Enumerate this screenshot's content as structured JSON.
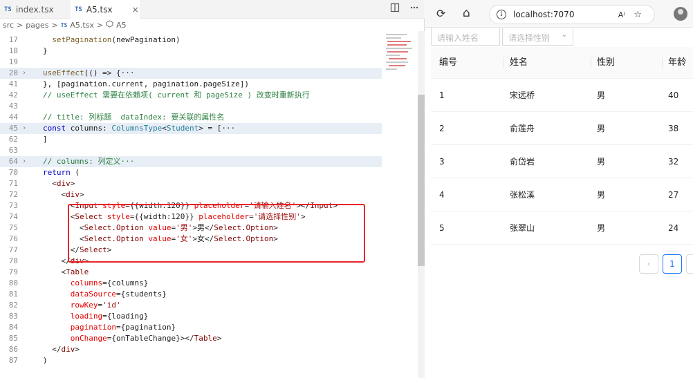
{
  "editor": {
    "tabs": [
      {
        "prefix": "TS",
        "label": "index.tsx"
      },
      {
        "prefix": "TS",
        "label": "A5.tsx",
        "close": "×"
      }
    ],
    "breadcrumb": {
      "src": "src",
      "pages": "pages",
      "prefix": "TS",
      "file": "A5.tsx",
      "symbol": "A5",
      "sep": ">"
    },
    "fold_glyph": "›",
    "lines": [
      {
        "n": "17",
        "t": "  setPagination(newPagination)"
      },
      {
        "n": "18",
        "t": "}"
      },
      {
        "n": "19",
        "t": ""
      },
      {
        "n": "20",
        "t": "useEffect(() => {···",
        "fold": true
      },
      {
        "n": "41",
        "t": "}, [pagination.current, pagination.pageSize])"
      },
      {
        "n": "42",
        "t": "// useEffect 需要在依赖项( current 和 pageSize ) 改变时重新执行"
      },
      {
        "n": "43",
        "t": ""
      },
      {
        "n": "44",
        "t": "// title: 列标题  dataIndex: 要关联的属性名"
      },
      {
        "n": "45",
        "t": "const columns: ColumnsType<Student> = [···",
        "fold": true
      },
      {
        "n": "62",
        "t": "]"
      },
      {
        "n": "63",
        "t": ""
      },
      {
        "n": "64",
        "t": "// columns: 列定义···",
        "fold": true
      },
      {
        "n": "70",
        "t": "return ("
      },
      {
        "n": "71",
        "t": "  <div>"
      },
      {
        "n": "72",
        "t": "    <div>"
      },
      {
        "n": "73",
        "t": "      <Input style={{width:120}} placeholder='请输入姓名'></Input>"
      },
      {
        "n": "74",
        "t": "      <Select style={{width:120}} placeholder='请选择性别'>"
      },
      {
        "n": "75",
        "t": "        <Select.Option value='男'>男</Select.Option>"
      },
      {
        "n": "76",
        "t": "        <Select.Option value='女'>女</Select.Option>"
      },
      {
        "n": "77",
        "t": "      </Select>"
      },
      {
        "n": "78",
        "t": "    </div>"
      },
      {
        "n": "79",
        "t": "    <Table"
      },
      {
        "n": "80",
        "t": "      columns={columns}"
      },
      {
        "n": "81",
        "t": "      dataSource={students}"
      },
      {
        "n": "82",
        "t": "      rowKey='id'"
      },
      {
        "n": "83",
        "t": "      loading={loading}"
      },
      {
        "n": "84",
        "t": "      pagination={pagination}"
      },
      {
        "n": "85",
        "t": "      onChange={onTableChange}></Table>"
      },
      {
        "n": "86",
        "t": "  </div>"
      },
      {
        "n": "87",
        "t": ")"
      }
    ]
  },
  "browser": {
    "url": "localhost:7070",
    "reader_label": "A⁾",
    "info_glyph": "i",
    "icons": {
      "refresh": "⟳",
      "home": "⌂",
      "favorite": "☆"
    },
    "filters": {
      "name_placeholder": "请输入姓名",
      "gender_placeholder": "请选择性别",
      "chevron": "⌄"
    },
    "table": {
      "headers": [
        "编号",
        "姓名",
        "性别",
        "年龄"
      ],
      "rows": [
        [
          "1",
          "宋远桥",
          "男",
          "40"
        ],
        [
          "2",
          "俞莲舟",
          "男",
          "38"
        ],
        [
          "3",
          "俞岱岩",
          "男",
          "32"
        ],
        [
          "4",
          "张松溪",
          "男",
          "27"
        ],
        [
          "5",
          "张翠山",
          "男",
          "24"
        ]
      ]
    },
    "pagination": {
      "prev": "‹",
      "current": "1"
    }
  },
  "colors": {
    "highlight": "#e8242b",
    "accent": "#1677ff"
  }
}
